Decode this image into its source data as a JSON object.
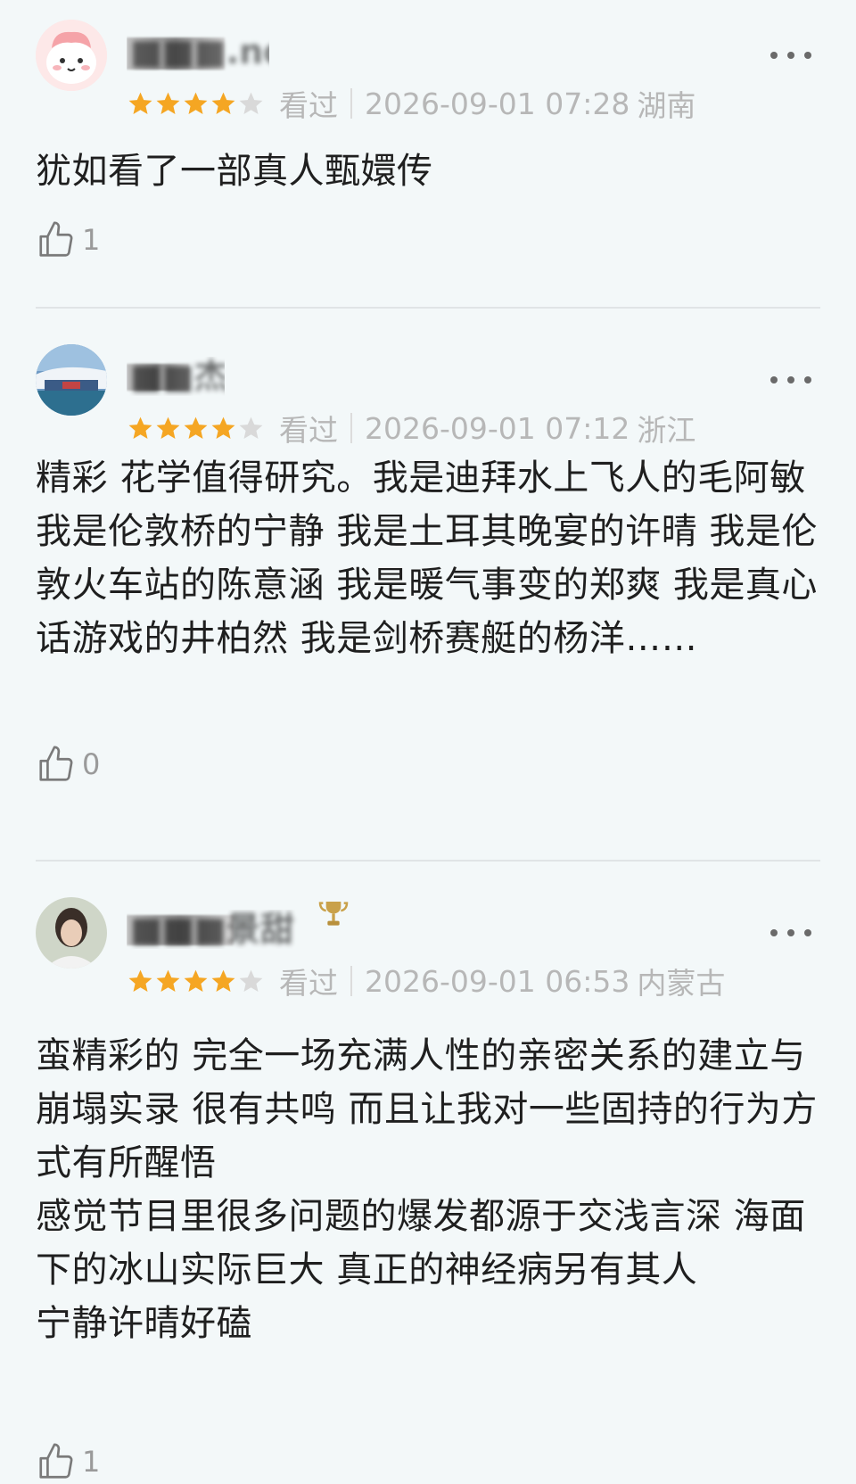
{
  "colors": {
    "background": "#f3f8f9",
    "star_filled": "#f5a623",
    "star_empty": "#d9d9d9",
    "meta_text": "#b7b7b7",
    "body_text": "#1f1f1f"
  },
  "comments": [
    {
      "username": "■■■.no",
      "avatar_icon": "pink-cartoon-avatar",
      "rating": 4,
      "rating_max": 5,
      "status": "看过",
      "timestamp": "2026-09-01 07:28",
      "location": "湖南",
      "text": "犹如看了一部真人甄嬛传",
      "like_icon": "thumbs-up-icon",
      "likes": "1"
    },
    {
      "username": "■■杰",
      "avatar_icon": "photo-avatar-building",
      "rating": 4,
      "rating_max": 5,
      "status": "看过",
      "timestamp": "2026-09-01 07:12",
      "location": "浙江",
      "text": "精彩 花学值得研究。我是迪拜水上飞人的毛阿敏 我是伦敦桥的宁静 我是土耳其晚宴的许晴 我是伦敦火车站的陈意涵 我是暖气事变的郑爽 我是真心话游戏的井柏然 我是剑桥赛艇的杨洋……",
      "like_icon": "thumbs-up-icon",
      "likes": "0"
    },
    {
      "username": "■■■景甜",
      "avatar_icon": "photo-avatar-person",
      "badge_icon": "trophy-badge-icon",
      "rating": 4,
      "rating_max": 5,
      "status": "看过",
      "timestamp": "2026-09-01 06:53",
      "location": "内蒙古",
      "text": "蛮精彩的 完全一场充满人性的亲密关系的建立与崩塌实录 很有共鸣 而且让我对一些固持的行为方式有所醒悟\n感觉节目里很多问题的爆发都源于交浅言深 海面下的冰山实际巨大 真正的神经病另有其人\n宁静许晴好磕",
      "like_icon": "thumbs-up-icon",
      "likes": "1"
    }
  ]
}
